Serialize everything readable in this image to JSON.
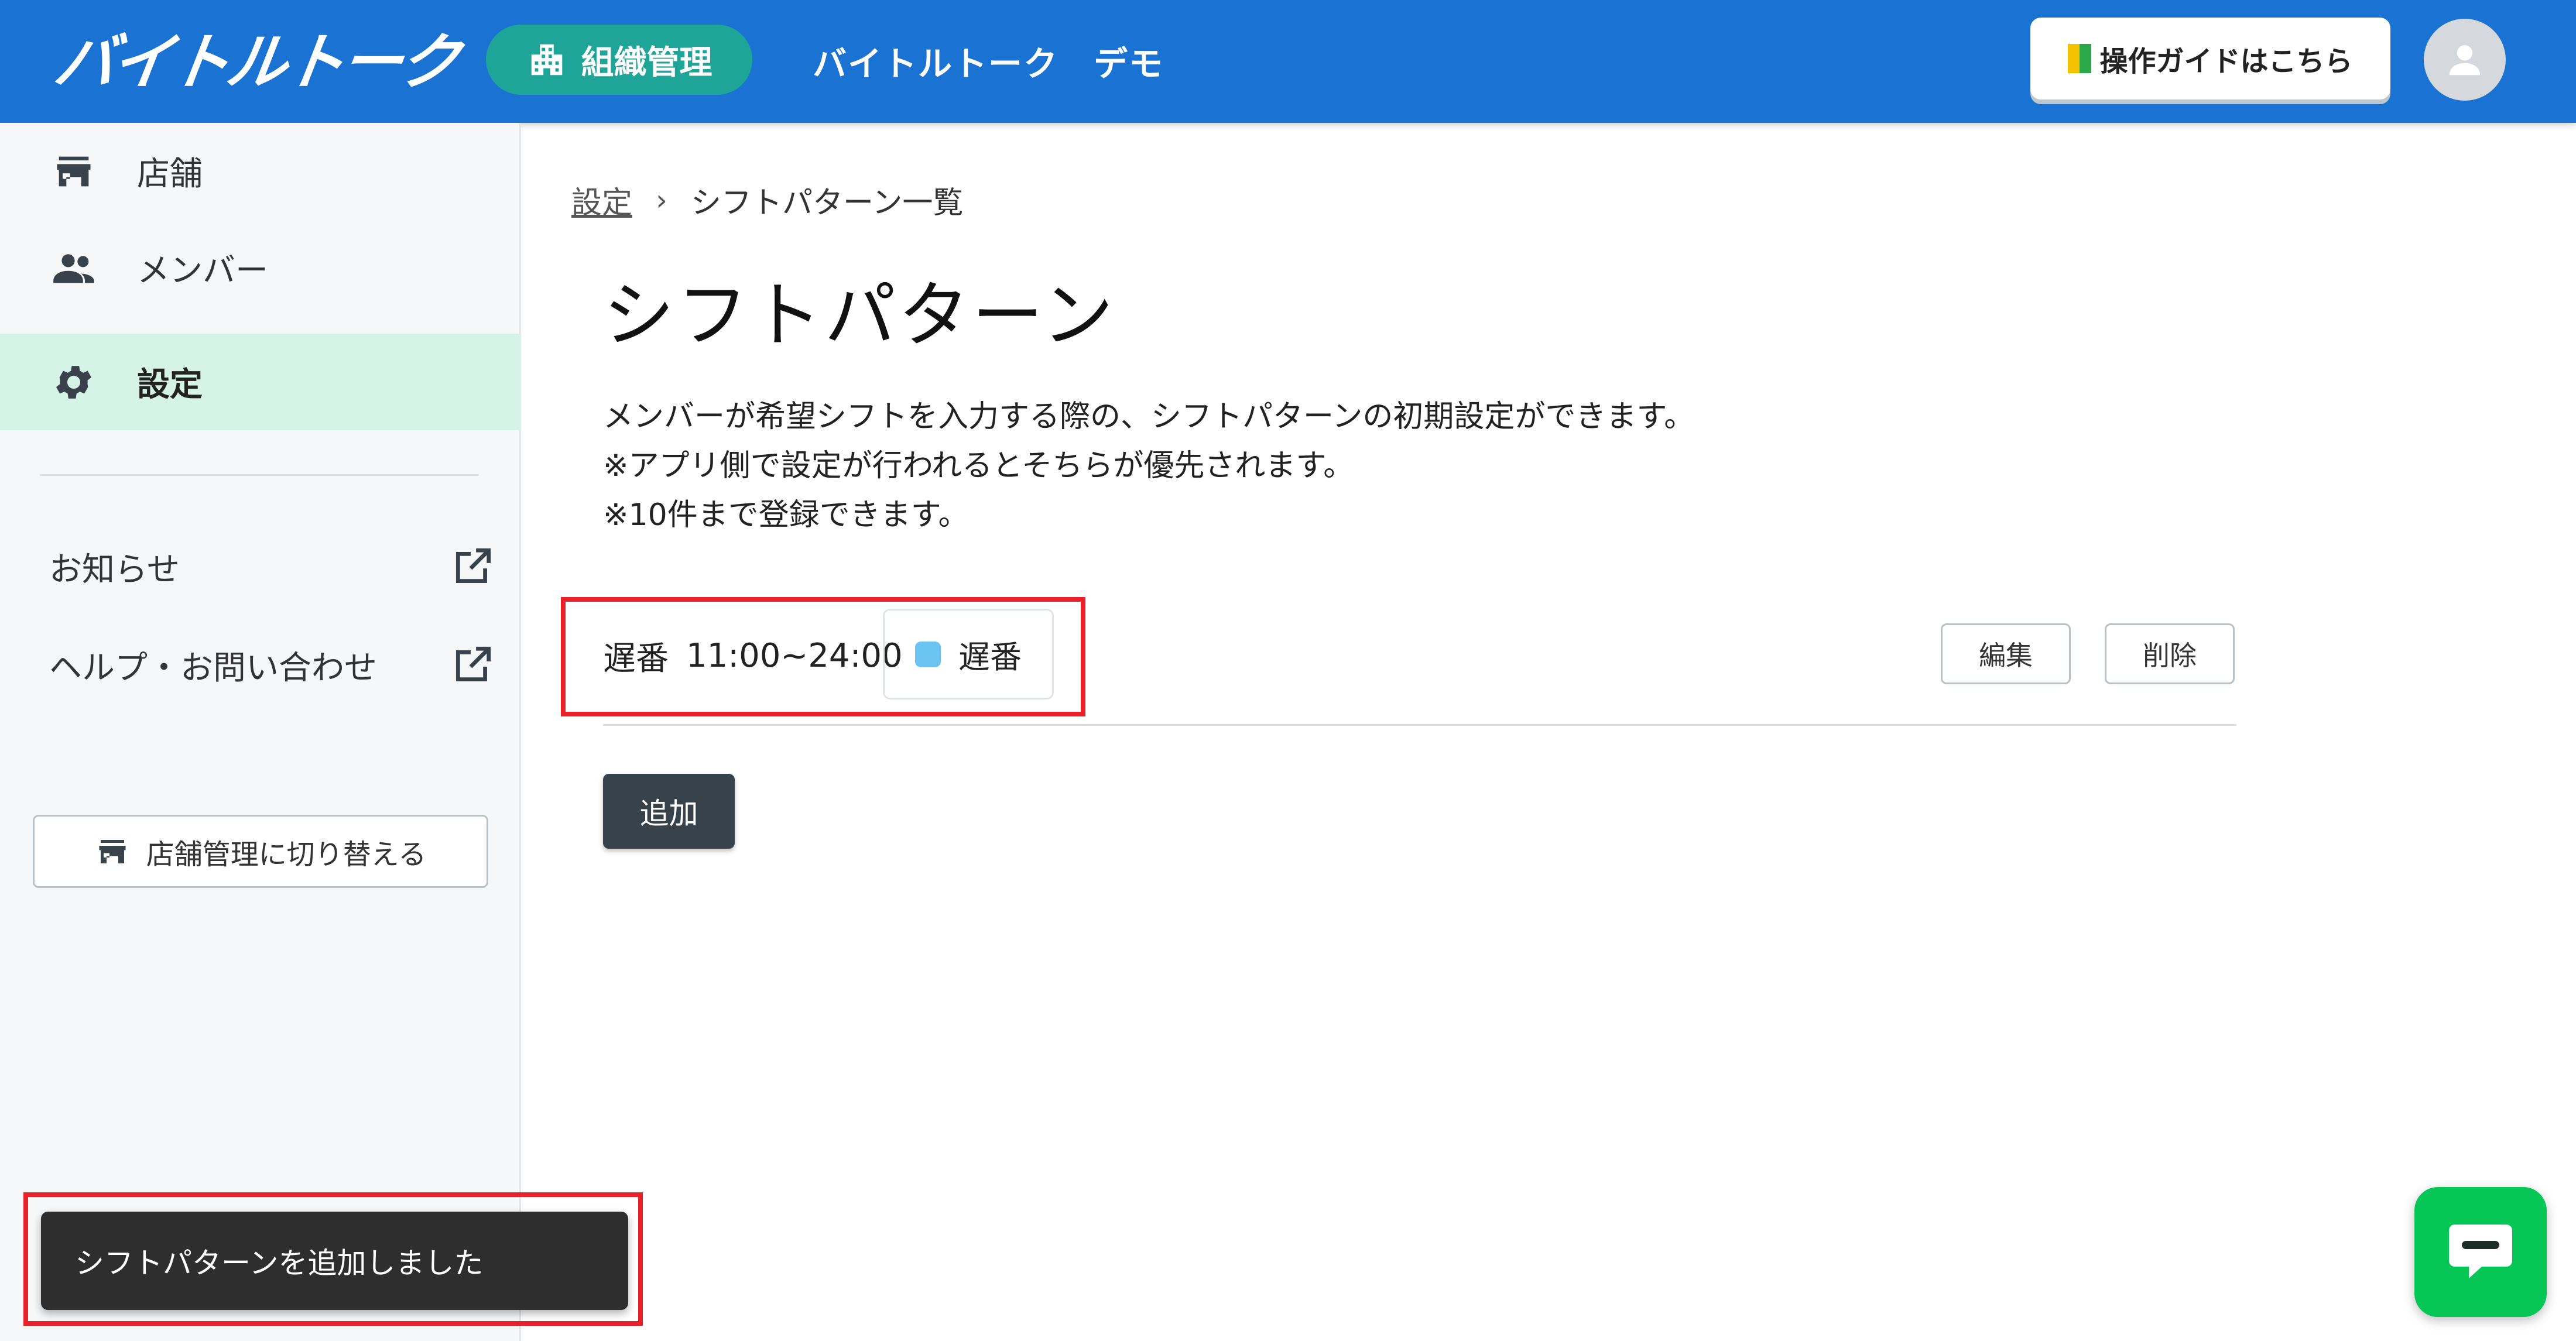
{
  "header": {
    "logo_text": "バイトルトーク",
    "org_label": "組織管理",
    "app_name": "バイトルトーク　デモ",
    "guide_label": "操作ガイドはこちら"
  },
  "sidebar": {
    "items": [
      {
        "label": "店舗",
        "icon": "store-icon"
      },
      {
        "label": "メンバー",
        "icon": "people-icon"
      },
      {
        "label": "設定",
        "icon": "gear-icon",
        "active": true
      }
    ],
    "links": [
      {
        "label": "お知らせ",
        "icon": "external-link-icon"
      },
      {
        "label": "ヘルプ・お問い合わせ",
        "icon": "external-link-icon"
      }
    ],
    "switch_label": "店舗管理に切り替える"
  },
  "breadcrumb": {
    "parent": "設定",
    "separator": "›",
    "current": "シフトパターン一覧"
  },
  "page": {
    "title": "シフトパターン",
    "desc_line1": "メンバーが希望シフトを入力する際の、シフトパターンの初期設定ができます。",
    "desc_line2": "※アプリ側で設定が行われるとそちらが優先されます。",
    "desc_line3": "※10件まで登録できます。"
  },
  "patterns": [
    {
      "name": "遅番",
      "time": "11:00~24:00",
      "chip_label": "遅番",
      "chip_color": "#6bc3f2"
    }
  ],
  "actions": {
    "edit_label": "編集",
    "delete_label": "削除",
    "add_label": "追加"
  },
  "toast": {
    "message": "シフトパターンを追加しました"
  },
  "colors": {
    "header": "#1a73d3",
    "org_pill": "#1ea597",
    "active_nav": "#d5f4e7",
    "chat_button": "#06c755",
    "annotation": "#e8202a"
  }
}
